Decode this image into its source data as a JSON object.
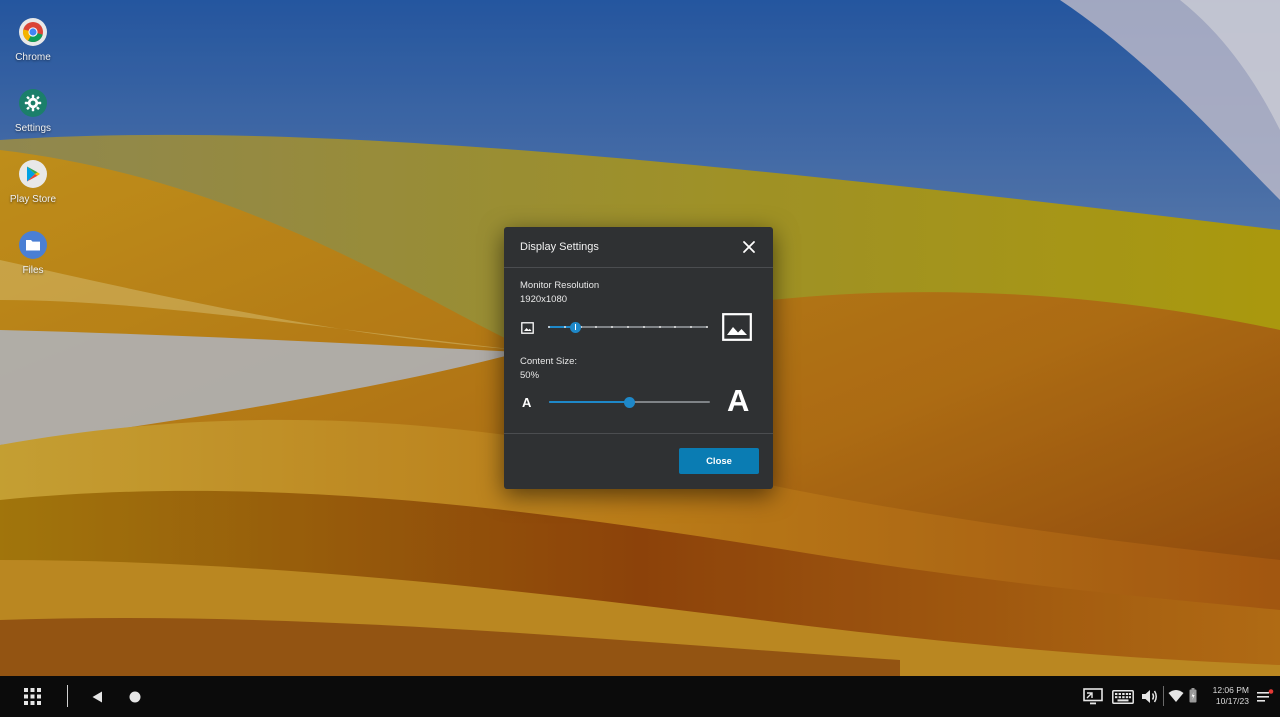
{
  "desktop": {
    "icons": [
      {
        "label": "Chrome"
      },
      {
        "label": "Settings"
      },
      {
        "label": "Play Store"
      },
      {
        "label": "Files"
      }
    ]
  },
  "dialog": {
    "title": "Display Settings",
    "resolution": {
      "label": "Monitor Resolution",
      "value": "1920x1080",
      "slider_position": 0.17,
      "tick_count": 11
    },
    "content_size": {
      "label": "Content Size:",
      "value": "50%",
      "slider_position": 0.5,
      "small_glyph": "A",
      "large_glyph": "A"
    },
    "close_button_label": "Close"
  },
  "taskbar": {
    "time": "12:06 PM",
    "date": "10/17/23"
  },
  "colors": {
    "accent": "#1e88c9",
    "button": "#0a7cb3",
    "dialog_bg": "#2f3133",
    "taskbar_bg": "#0b0b0b"
  }
}
